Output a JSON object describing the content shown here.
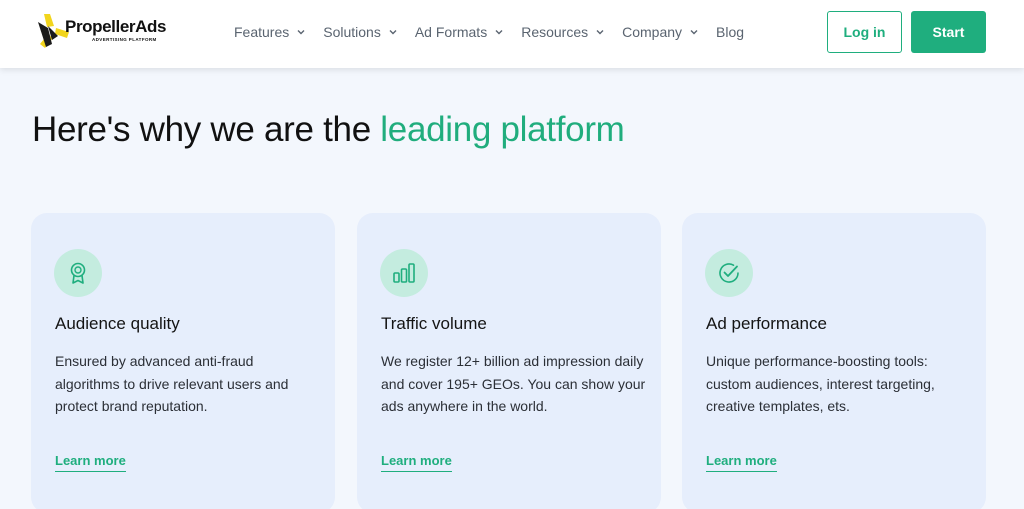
{
  "brand": {
    "name": "PropellerAds",
    "tagline": "ADVERTISING PLATFORM",
    "accent_color": "#1fae7e"
  },
  "nav": {
    "items": [
      {
        "label": "Features",
        "has_dropdown": true
      },
      {
        "label": "Solutions",
        "has_dropdown": true
      },
      {
        "label": "Ad Formats",
        "has_dropdown": true
      },
      {
        "label": "Resources",
        "has_dropdown": true
      },
      {
        "label": "Company",
        "has_dropdown": true
      },
      {
        "label": "Blog",
        "has_dropdown": false
      }
    ],
    "login_label": "Log in",
    "start_label": "Start"
  },
  "hero": {
    "title_plain": "Here's why we are the ",
    "title_accent": "leading platform"
  },
  "cards": [
    {
      "icon": "award-ribbon-icon",
      "title": "Audience quality",
      "description": "Ensured by advanced anti-fraud algorithms to drive relevant users and protect brand reputation.",
      "link": "Learn more"
    },
    {
      "icon": "bar-chart-icon",
      "title": "Traffic volume",
      "description": "We register 12+ billion ad impression daily and cover 195+ GEOs. You can show your ads anywhere in the world.",
      "link": "Learn more"
    },
    {
      "icon": "check-circle-icon",
      "title": "Ad performance",
      "description": "Unique performance-boosting tools: custom audiences, interest targeting, creative templates, ets.",
      "link": "Learn more"
    }
  ]
}
